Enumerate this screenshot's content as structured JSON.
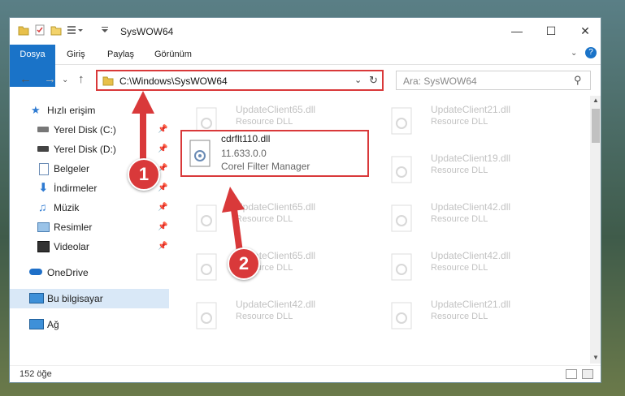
{
  "window": {
    "title": "SysWOW64"
  },
  "ribbon": {
    "tabs": [
      "Dosya",
      "Giriş",
      "Paylaş",
      "Görünüm"
    ]
  },
  "address": {
    "path": "C:\\Windows\\SysWOW64"
  },
  "search": {
    "placeholder": "Ara: SysWOW64"
  },
  "sidebar": {
    "items": [
      {
        "label": "Hızlı erişim",
        "icon": "star-icon"
      },
      {
        "label": "Yerel Disk (C:)",
        "icon": "drive-icon"
      },
      {
        "label": "Yerel Disk (D:)",
        "icon": "drive-icon"
      },
      {
        "label": "Belgeler",
        "icon": "documents-icon"
      },
      {
        "label": "İndirmeler",
        "icon": "download-icon"
      },
      {
        "label": "Müzik",
        "icon": "music-icon"
      },
      {
        "label": "Resimler",
        "icon": "pictures-icon"
      },
      {
        "label": "Videolar",
        "icon": "videos-icon"
      },
      {
        "label": "OneDrive",
        "icon": "cloud-icon"
      },
      {
        "label": "Bu bilgisayar",
        "icon": "computer-icon"
      },
      {
        "label": "Ağ",
        "icon": "network-icon"
      }
    ]
  },
  "files": {
    "left": [
      {
        "name": "UpdateClient65.dll",
        "sub": "Resource DLL"
      },
      {
        "name": "UpdateClient65.dll",
        "sub": "Resource DLL"
      },
      {
        "name": "UpdateClient65.dll",
        "sub": "Resource DLL"
      },
      {
        "name": "UpdateClient42.dll",
        "sub": "Resource DLL"
      }
    ],
    "right": [
      {
        "name": "UpdateClient21.dll",
        "sub": "Resource DLL"
      },
      {
        "name": "UpdateClient19.dll",
        "sub": "Resource DLL"
      },
      {
        "name": "UpdateClient42.dll",
        "sub": "Resource DLL"
      },
      {
        "name": "UpdateClient42.dll",
        "sub": "Resource DLL"
      },
      {
        "name": "UpdateClient21.dll",
        "sub": "Resource DLL"
      }
    ],
    "target": {
      "name": "cdrflt110.dll",
      "version": "11.633.0.0",
      "description": "Corel Filter Manager"
    }
  },
  "status": {
    "count": "152 öğe"
  },
  "annotations": {
    "badge1": "1",
    "badge2": "2"
  },
  "colors": {
    "accent": "#d9393a",
    "file_tab": "#1a73c8"
  }
}
